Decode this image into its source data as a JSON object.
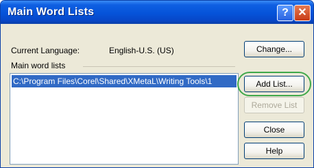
{
  "window": {
    "title": "Main Word Lists",
    "help_glyph": "?",
    "close_glyph": "✕"
  },
  "current_language": {
    "label": "Current Language:",
    "value": "English-U.S. (US)"
  },
  "main_lists": {
    "group_label": "Main word lists",
    "items": [
      "C:\\Program Files\\Corel\\Shared\\XMetaL\\Writing Tools\\1"
    ]
  },
  "buttons": {
    "change": "Change...",
    "add_list": "Add List...",
    "remove_list": "Remove List",
    "close": "Close",
    "help": "Help"
  },
  "colors": {
    "title_bar": "#0553d9",
    "selection": "#316ac5",
    "highlight_ring": "#3fa84a"
  }
}
